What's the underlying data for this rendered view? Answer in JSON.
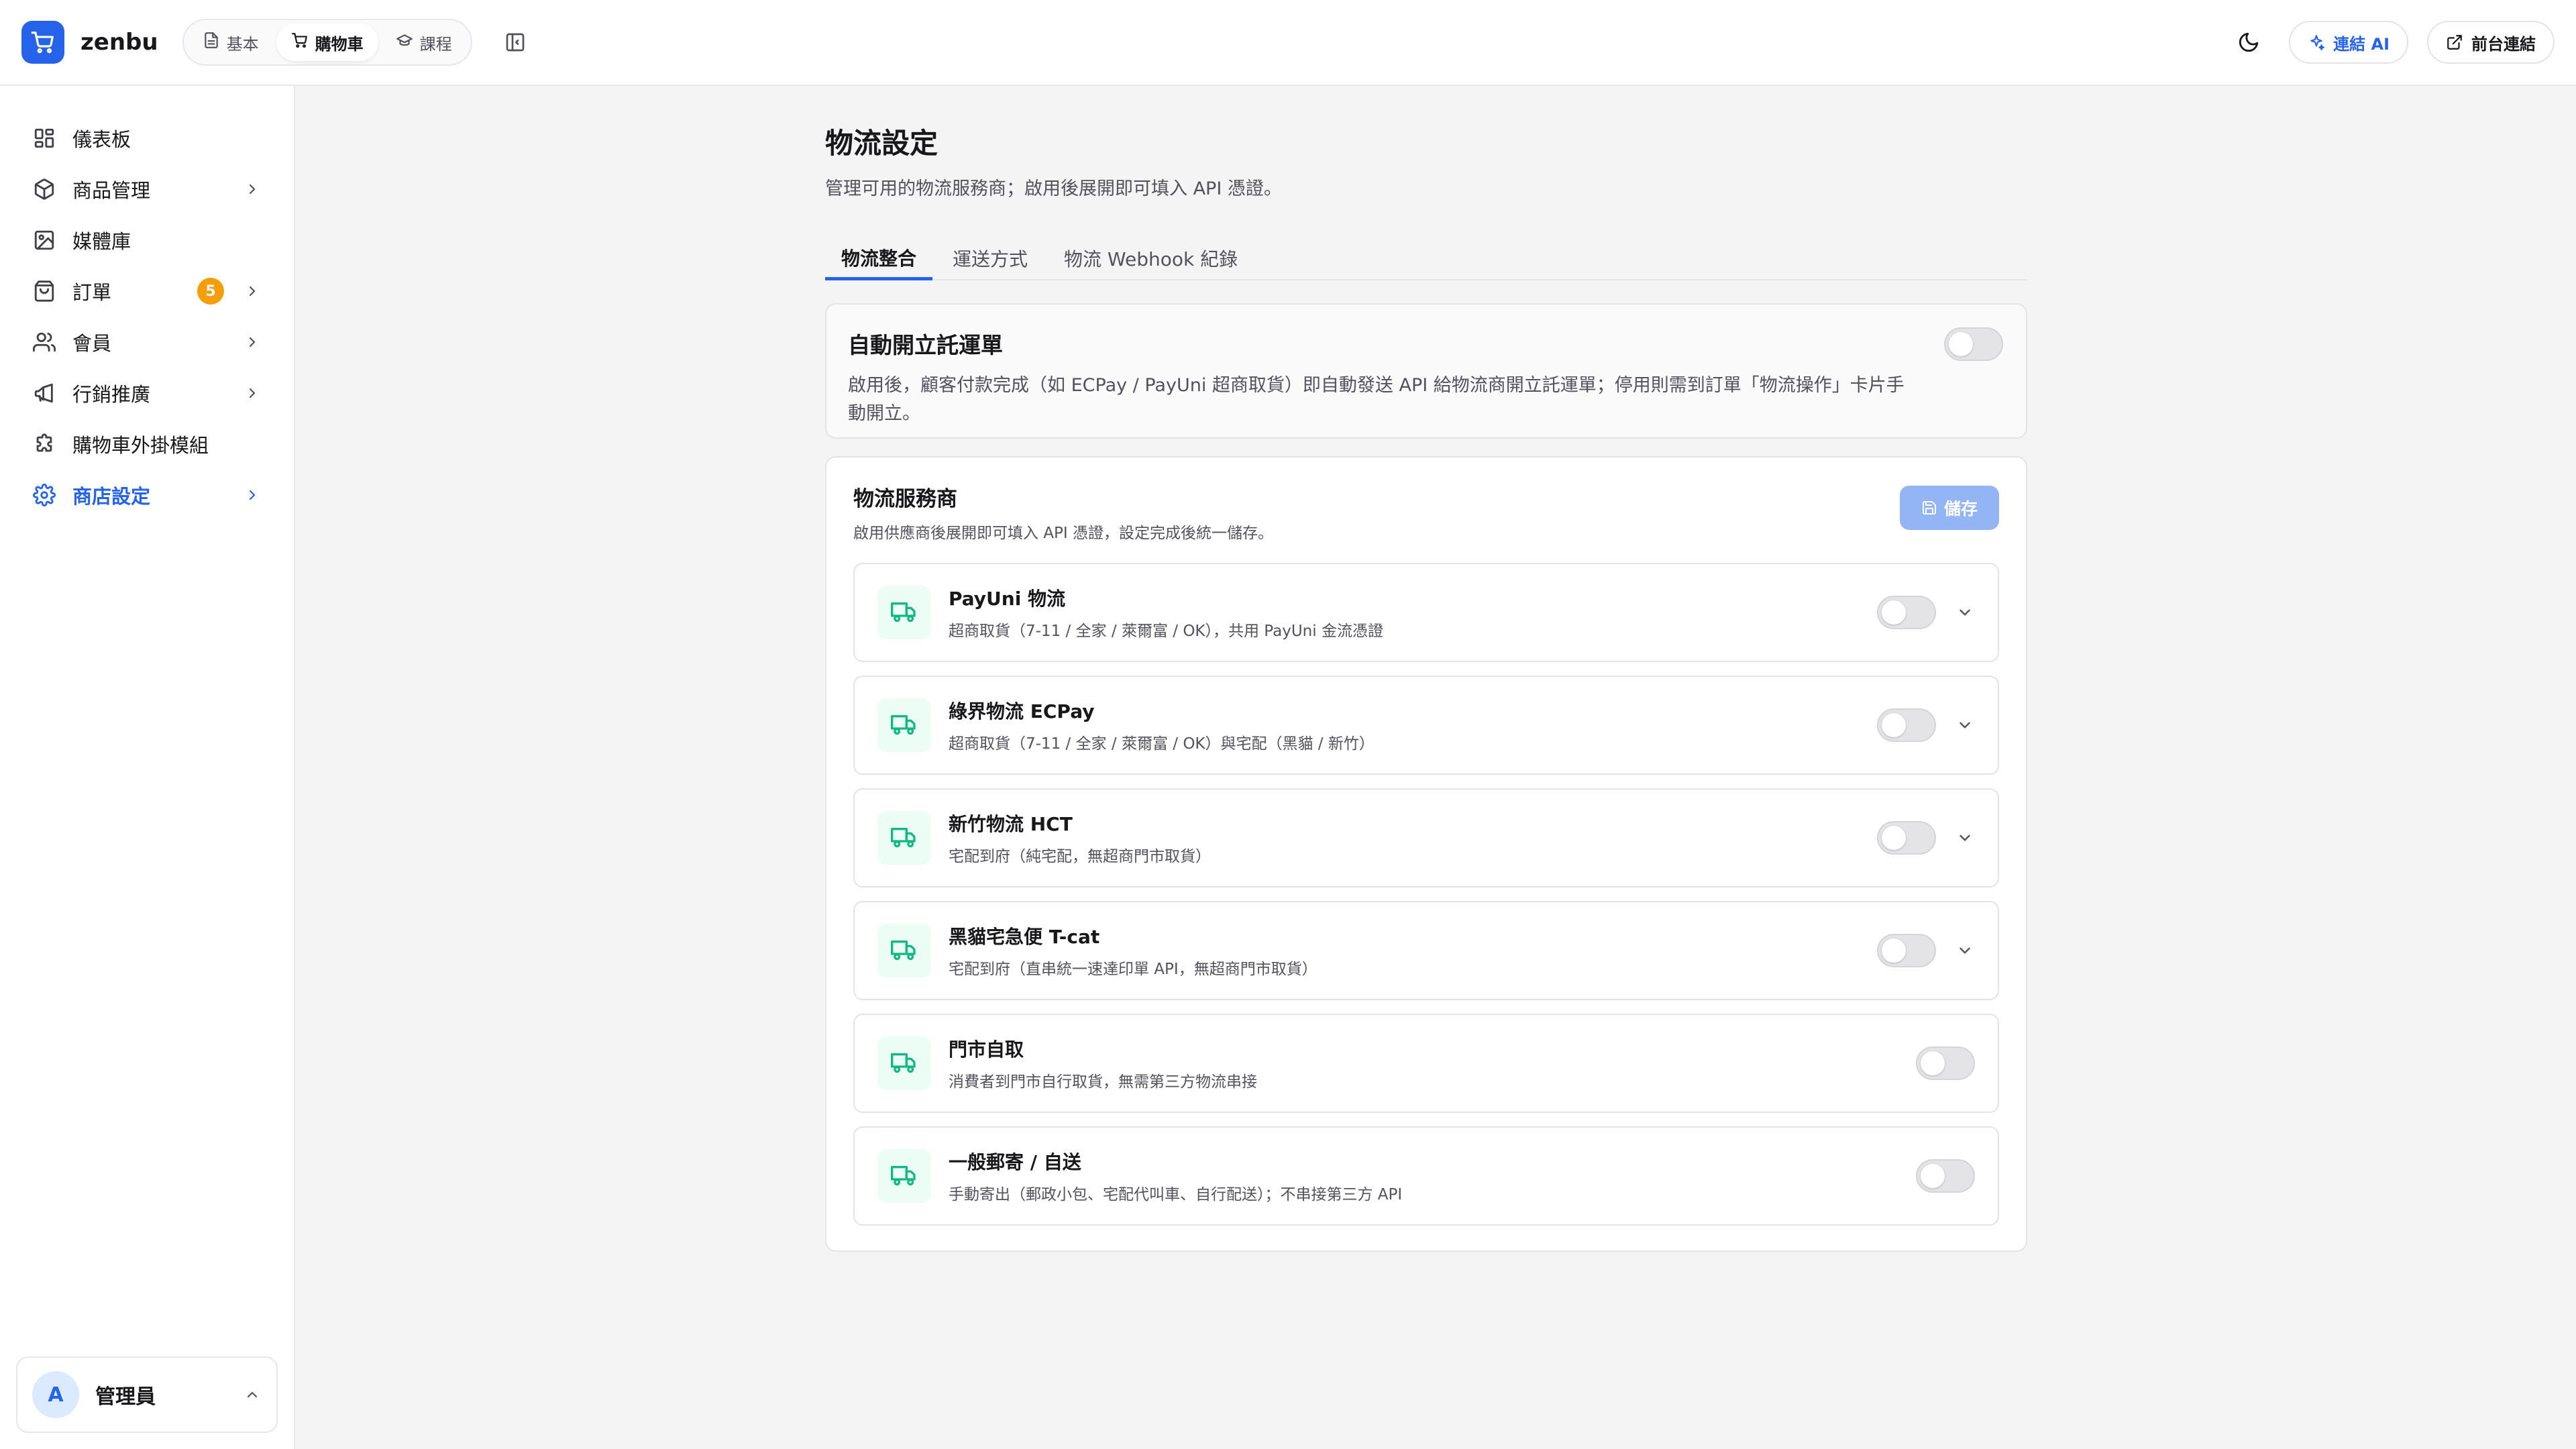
{
  "header": {
    "brand": "zenbu",
    "segments": [
      {
        "label": "基本",
        "icon": "document-icon"
      },
      {
        "label": "購物車",
        "icon": "cart-icon"
      },
      {
        "label": "課程",
        "icon": "graduation-cap-icon"
      }
    ],
    "active_segment": "購物車",
    "ai_button": "連結 AI",
    "frontend_button": "前台連結"
  },
  "sidebar": {
    "items": [
      {
        "label": "儀表板",
        "icon": "dashboard-icon"
      },
      {
        "label": "商品管理",
        "icon": "package-icon"
      },
      {
        "label": "媒體庫",
        "icon": "image-icon"
      },
      {
        "label": "訂單",
        "icon": "shopping-bag-icon",
        "badge": "5"
      },
      {
        "label": "會員",
        "icon": "users-icon"
      },
      {
        "label": "行銷推廣",
        "icon": "megaphone-icon"
      },
      {
        "label": "購物車外掛模組",
        "icon": "puzzle-icon"
      },
      {
        "label": "商店設定",
        "icon": "gear-icon"
      }
    ],
    "user": {
      "initial": "A",
      "name": "管理員"
    }
  },
  "main": {
    "title": "物流設定",
    "subtitle": "管理可用的物流服務商；啟用後展開即可填入 API 憑證。",
    "tabs": [
      "物流整合",
      "運送方式",
      "物流 Webhook 紀錄"
    ],
    "active_tab": "物流整合",
    "auto": {
      "title": "自動開立託運單",
      "desc": "啟用後，顧客付款完成（如 ECPay / PayUni 超商取貨）即自動發送 API 給物流商開立託運單；停用則需到訂單「物流操作」卡片手動開立。",
      "enabled": false
    },
    "providers_card": {
      "title": "物流服務商",
      "desc": "啟用供應商後展開即可填入 API 憑證，設定完成後統一儲存。",
      "save_label": "儲存"
    },
    "providers": [
      {
        "name": "PayUni 物流",
        "desc": "超商取貨（7-11 / 全家 / 萊爾富 / OK），共用 PayUni 金流憑證",
        "enabled": false,
        "expandable": true
      },
      {
        "name": "綠界物流 ECPay",
        "desc": "超商取貨（7-11 / 全家 / 萊爾富 / OK）與宅配（黑貓 / 新竹）",
        "enabled": false,
        "expandable": true
      },
      {
        "name": "新竹物流 HCT",
        "desc": "宅配到府（純宅配，無超商門市取貨）",
        "enabled": false,
        "expandable": true
      },
      {
        "name": "黑貓宅急便 T-cat",
        "desc": "宅配到府（直串統一速達印單 API，無超商門市取貨）",
        "enabled": false,
        "expandable": true
      },
      {
        "name": "門市自取",
        "desc": "消費者到門市自行取貨，無需第三方物流串接",
        "enabled": false,
        "expandable": false
      },
      {
        "name": "一般郵寄 / 自送",
        "desc": "手動寄出（郵政小包、宅配代叫車、自行配送）；不串接第三方 API",
        "enabled": false,
        "expandable": false
      }
    ]
  },
  "colors": {
    "accent": "#2563eb",
    "badge": "#f59e0b",
    "truck": "#10b981"
  }
}
